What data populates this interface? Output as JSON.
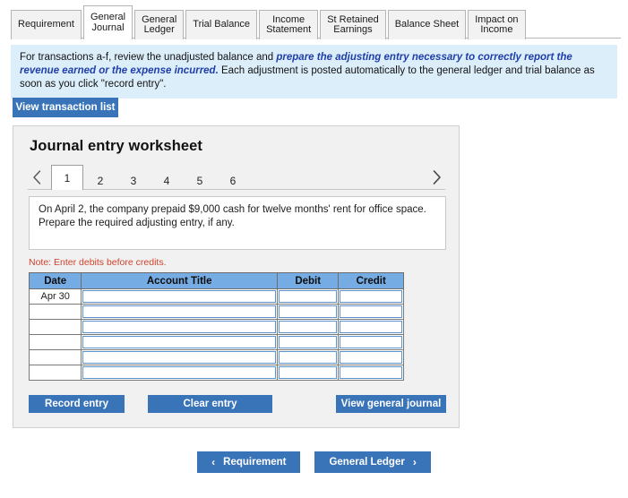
{
  "tabs": [
    {
      "label": "Requirement",
      "active": false
    },
    {
      "label": "General\nJournal",
      "active": true
    },
    {
      "label": "General\nLedger",
      "active": false
    },
    {
      "label": "Trial Balance",
      "active": false
    },
    {
      "label": "Income\nStatement",
      "active": false
    },
    {
      "label": "St Retained\nEarnings",
      "active": false
    },
    {
      "label": "Balance Sheet",
      "active": false
    },
    {
      "label": "Impact on\nIncome",
      "active": false
    }
  ],
  "banner": {
    "part1": "For transactions a-f, review the unadjusted balance and ",
    "emphasis": "prepare the adjusting entry necessary to correctly report the revenue earned or the expense incurred.",
    "part2": "  Each adjustment is posted automatically to the general ledger and trial balance as soon as you click \"record entry\".",
    "background_color": "#ddeefb",
    "emphasis_color": "#1f3fa8"
  },
  "toolbar": {
    "view_transaction_list_label": "View transaction list"
  },
  "panel": {
    "title": "Journal entry worksheet",
    "pager": {
      "prev_icon": "chevron-left-icon",
      "next_icon": "chevron-right-icon",
      "pages": [
        "1",
        "2",
        "3",
        "4",
        "5",
        "6"
      ],
      "active_page": "1"
    },
    "question": "On April 2, the company prepaid $9,000 cash for twelve months' rent for office space. Prepare the required adjusting entry, if any.",
    "note": "Note: Enter debits before credits.",
    "note_color": "#d0432c",
    "table": {
      "header_color": "#76ace4",
      "columns": [
        "Date",
        "Account Title",
        "Debit",
        "Credit"
      ],
      "rows": [
        {
          "date": "Apr 30",
          "account": "",
          "debit": "",
          "credit": ""
        },
        {
          "date": "",
          "account": "",
          "debit": "",
          "credit": ""
        },
        {
          "date": "",
          "account": "",
          "debit": "",
          "credit": ""
        },
        {
          "date": "",
          "account": "",
          "debit": "",
          "credit": ""
        },
        {
          "date": "",
          "account": "",
          "debit": "",
          "credit": ""
        },
        {
          "date": "",
          "account": "",
          "debit": "",
          "credit": ""
        }
      ]
    },
    "actions": {
      "record_entry_label": "Record entry",
      "clear_entry_label": "Clear entry",
      "view_general_journal_label": "View general journal"
    }
  },
  "bottom_nav": {
    "prev_label": "Requirement",
    "prev_icon": "chevron-left-icon",
    "next_label": "General Ledger",
    "next_icon": "chevron-right-icon"
  },
  "colors": {
    "button_blue": "#3a74b8",
    "panel_bg": "#f1f1f1"
  }
}
